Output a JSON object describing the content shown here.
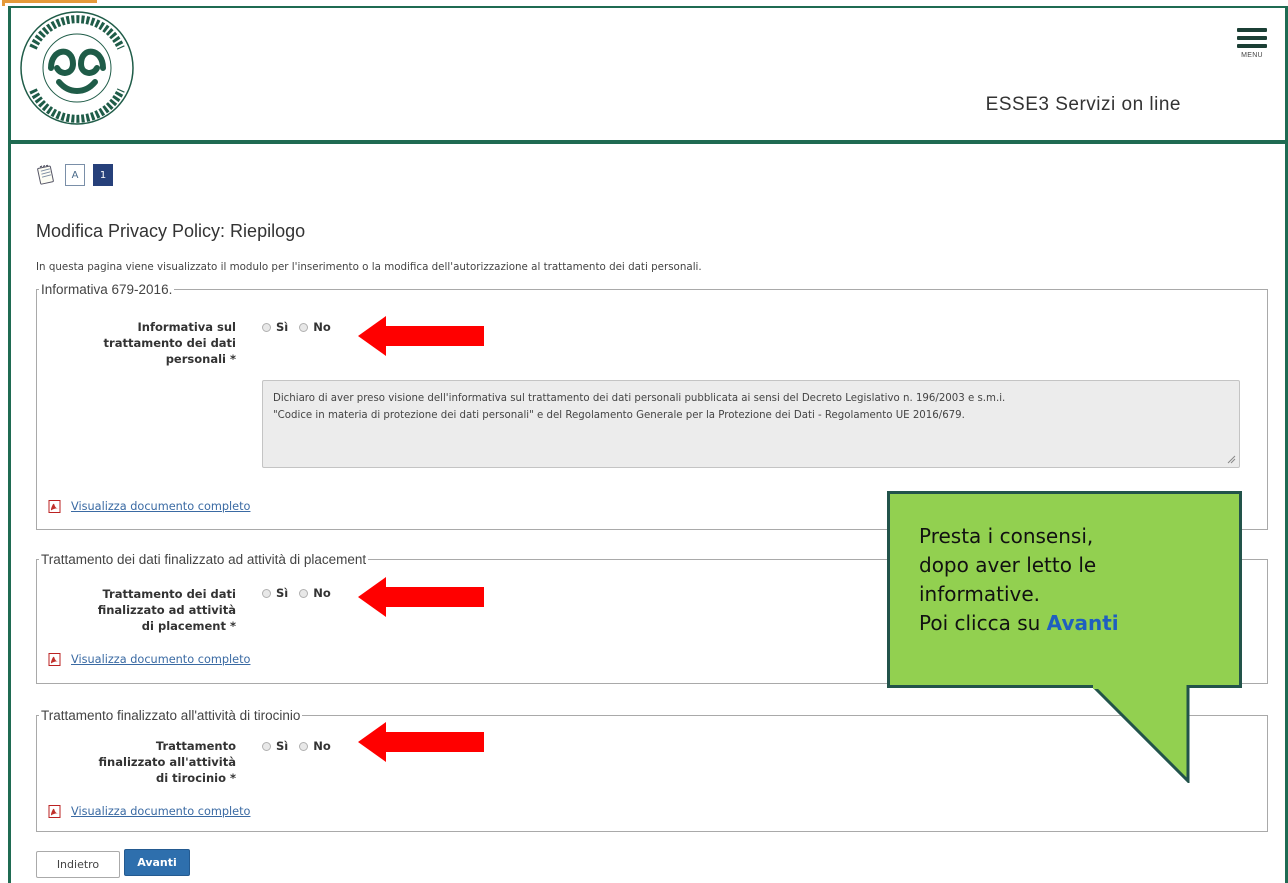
{
  "header": {
    "site_title": "ESSE3 Servizi on line",
    "menu_label": "MENU",
    "logo_icon": "university-seal-logo"
  },
  "steps": [
    {
      "label": "A",
      "active": false
    },
    {
      "label": "1",
      "active": true
    }
  ],
  "page": {
    "title": "Modifica Privacy Policy: Riepilogo",
    "intro": "In questa pagina viene visualizzato il modulo per l'inserimento o la modifica dell'autorizzazione al trattamento dei dati personali."
  },
  "sections": [
    {
      "legend": "Informativa 679-2016.",
      "label_lines": [
        "Informativa sul",
        "trattamento dei dati",
        "personali *"
      ],
      "yes": "Sì",
      "no": "No",
      "info_text_1": "Dichiaro di aver preso visione dell'informativa sul trattamento dei dati personali pubblicata ai sensi del Decreto Legislativo n. 196/2003 e s.m.i.",
      "info_text_2": "\"Codice in materia di protezione dei dati personali\" e del Regolamento Generale per la Protezione dei Dati - Regolamento UE 2016/679.",
      "link": "Visualizza documento completo"
    },
    {
      "legend": "Trattamento dei dati finalizzato ad attività di placement",
      "label_lines": [
        "Trattamento dei dati",
        "finalizzato ad attività",
        "di placement *"
      ],
      "yes": "Sì",
      "no": "No",
      "link": "Visualizza documento completo"
    },
    {
      "legend": "Trattamento finalizzato all'attività di tirocinio",
      "label_lines": [
        "Trattamento",
        "finalizzato all'attività",
        "di tirocinio *"
      ],
      "yes": "Sì",
      "no": "No",
      "link": "Visualizza documento completo"
    }
  ],
  "callout": {
    "line1": "Presta i consensi,",
    "line2": "dopo aver letto le",
    "line3": "informative.",
    "line4_prefix": "Poi clicca su ",
    "line4_highlight": "Avanti"
  },
  "buttons": {
    "back": "Indietro",
    "next": "Avanti"
  },
  "colors": {
    "brand_green": "#1f6b52",
    "callout_green": "#92d050",
    "arrow_red": "#ff0000",
    "primary_button": "#2e6fad",
    "link_blue": "#3a6aa3"
  }
}
